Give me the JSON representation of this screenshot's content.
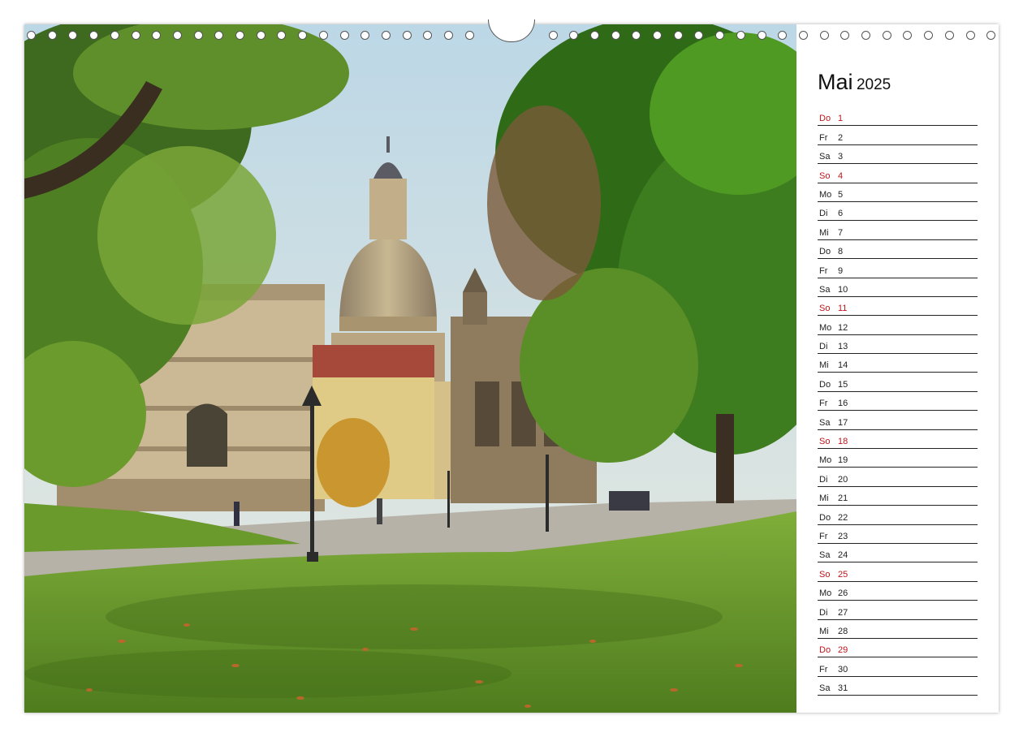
{
  "calendar": {
    "month": "Mai",
    "year": "2025",
    "days": [
      {
        "wd": "Do",
        "n": "1",
        "red": true
      },
      {
        "wd": "Fr",
        "n": "2",
        "red": false
      },
      {
        "wd": "Sa",
        "n": "3",
        "red": false
      },
      {
        "wd": "So",
        "n": "4",
        "red": true
      },
      {
        "wd": "Mo",
        "n": "5",
        "red": false
      },
      {
        "wd": "Di",
        "n": "6",
        "red": false
      },
      {
        "wd": "Mi",
        "n": "7",
        "red": false
      },
      {
        "wd": "Do",
        "n": "8",
        "red": false
      },
      {
        "wd": "Fr",
        "n": "9",
        "red": false
      },
      {
        "wd": "Sa",
        "n": "10",
        "red": false
      },
      {
        "wd": "So",
        "n": "11",
        "red": true
      },
      {
        "wd": "Mo",
        "n": "12",
        "red": false
      },
      {
        "wd": "Di",
        "n": "13",
        "red": false
      },
      {
        "wd": "Mi",
        "n": "14",
        "red": false
      },
      {
        "wd": "Do",
        "n": "15",
        "red": false
      },
      {
        "wd": "Fr",
        "n": "16",
        "red": false
      },
      {
        "wd": "Sa",
        "n": "17",
        "red": false
      },
      {
        "wd": "So",
        "n": "18",
        "red": true
      },
      {
        "wd": "Mo",
        "n": "19",
        "red": false
      },
      {
        "wd": "Di",
        "n": "20",
        "red": false
      },
      {
        "wd": "Mi",
        "n": "21",
        "red": false
      },
      {
        "wd": "Do",
        "n": "22",
        "red": false
      },
      {
        "wd": "Fr",
        "n": "23",
        "red": false
      },
      {
        "wd": "Sa",
        "n": "24",
        "red": false
      },
      {
        "wd": "So",
        "n": "25",
        "red": true
      },
      {
        "wd": "Mo",
        "n": "26",
        "red": false
      },
      {
        "wd": "Di",
        "n": "27",
        "red": false
      },
      {
        "wd": "Mi",
        "n": "28",
        "red": false
      },
      {
        "wd": "Do",
        "n": "29",
        "red": true
      },
      {
        "wd": "Fr",
        "n": "30",
        "red": false
      },
      {
        "wd": "Sa",
        "n": "31",
        "red": false
      }
    ]
  },
  "colors": {
    "holiday": "#c0161c",
    "text": "#222222"
  },
  "photo": {
    "icon": "dresden-frauenkirche-park-photo"
  }
}
